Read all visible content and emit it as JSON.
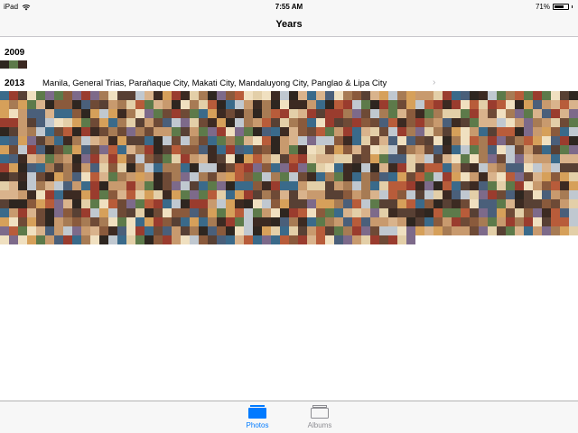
{
  "status_bar": {
    "device": "iPad",
    "time": "7:55 AM",
    "battery": "71%",
    "battery_level": 0.71,
    "icons": [
      "wifi-icon",
      "battery-icon"
    ]
  },
  "nav_bar": {
    "title": "Years"
  },
  "years": [
    {
      "year": "2009",
      "places": ""
    },
    {
      "year": "2013",
      "places": "Manila, General Trias, Parañaque City, Makati City, Mandaluyong City, Panglao & Lipa City"
    }
  ],
  "tab_bar": {
    "tabs": [
      {
        "label": "Photos",
        "icon": "photos-icon",
        "selected": true
      },
      {
        "label": "Albums",
        "icon": "albums-icon",
        "selected": false
      }
    ]
  },
  "colors": {
    "accent": "#007aff",
    "inactive": "#8e8e93",
    "bar_background": "#f7f7f7"
  }
}
